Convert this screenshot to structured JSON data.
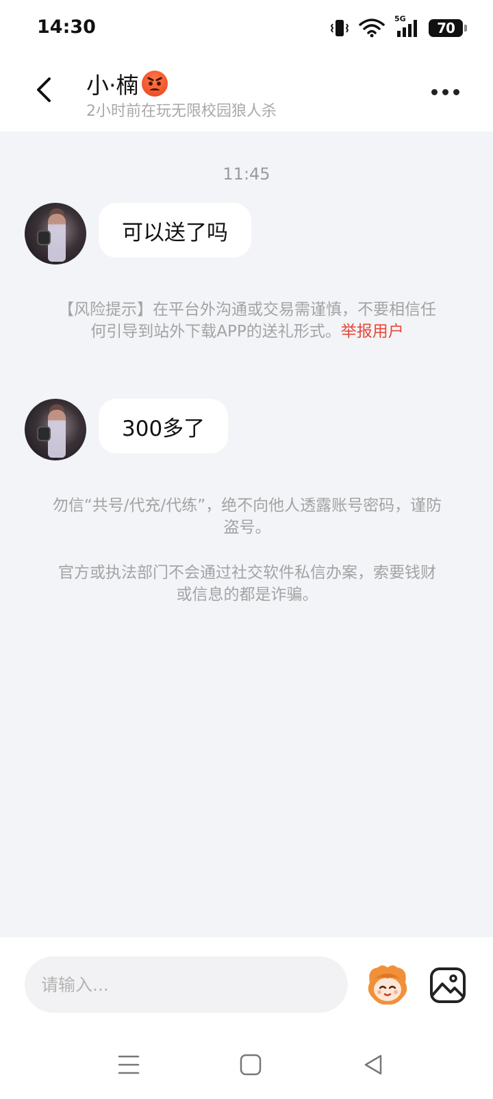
{
  "status_bar": {
    "time": "14:30",
    "battery_level": "70",
    "icons": [
      "vibrate-icon",
      "wifi-icon",
      "5g-signal-icon",
      "battery-icon"
    ],
    "network_label": "5G"
  },
  "header": {
    "back_icon": "chevron-left-icon",
    "contact_name": "小·楠",
    "name_emoji": "angry-face-emoji",
    "status_text": "2小时前在玩无限校园狼人杀",
    "more_icon": "more-dots-icon"
  },
  "messages": {
    "timestamp": "11:45",
    "items": [
      {
        "sender": "contact",
        "text": "可以送了吗"
      },
      {
        "sender": "contact",
        "text": "300多了"
      }
    ]
  },
  "notices": {
    "risk_warning": "【风险提示】在平台外沟通或交易需谨慎，不要相信任何引导到站外下载APP的送礼形式。",
    "report_link": "举报用户",
    "account_warning": "勿信“共号/代充/代练”，绝不向他人透露账号密码，谨防盗号。",
    "fraud_warning": "官方或执法部门不会通过社交软件私信办案，索要钱财或信息的都是诈骗。"
  },
  "input_bar": {
    "placeholder": "请输入...",
    "value": "",
    "mascot_icon": "mascot-sticker-icon",
    "image_icon": "image-icon"
  },
  "nav_bar": {
    "icons": [
      "menu-icon",
      "home-icon",
      "back-triangle-icon"
    ]
  },
  "colors": {
    "background": "#f2f4f7",
    "bubble": "#ffffff",
    "notice_text": "#a3a3a3",
    "report_link": "#e8463a"
  }
}
